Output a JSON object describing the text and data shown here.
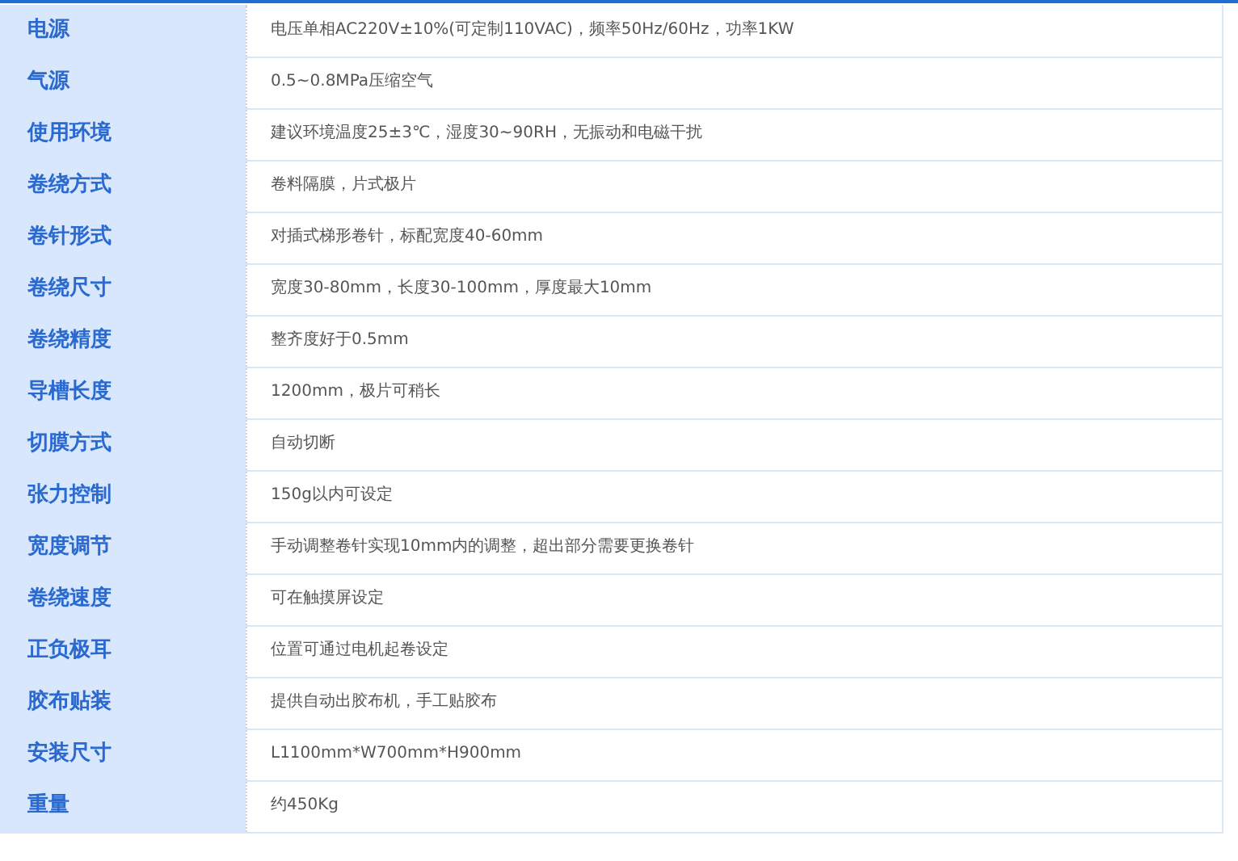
{
  "specs": [
    {
      "label": "电源",
      "value": "电压单相AC220V±10%(可定制110VAC)，频率50Hz/60Hz，功率1KW"
    },
    {
      "label": "气源",
      "value": "0.5~0.8MPa压缩空气"
    },
    {
      "label": "使用环境",
      "value": "建议环境温度25±3℃，湿度30~90RH，无振动和电磁干扰"
    },
    {
      "label": "卷绕方式",
      "value": "卷料隔膜，片式极片"
    },
    {
      "label": "卷针形式",
      "value": "对插式梯形卷针，标配宽度40-60mm"
    },
    {
      "label": "卷绕尺寸",
      "value": "宽度30-80mm，长度30-100mm，厚度最大10mm"
    },
    {
      "label": "卷绕精度",
      "value": "整齐度好于0.5mm"
    },
    {
      "label": "导槽长度",
      "value": "1200mm，极片可稍长"
    },
    {
      "label": "切膜方式",
      "value": "自动切断"
    },
    {
      "label": "张力控制",
      "value": "150g以内可设定"
    },
    {
      "label": "宽度调节",
      "value": "手动调整卷针实现10mm内的调整，超出部分需要更换卷针"
    },
    {
      "label": "卷绕速度",
      "value": "可在触摸屏设定"
    },
    {
      "label": "正负极耳",
      "value": "位置可通过电机起卷设定"
    },
    {
      "label": "胶布贴装",
      "value": "提供自动出胶布机，手工贴胶布"
    },
    {
      "label": "安装尺寸",
      "value": "L1100mm*W700mm*H900mm"
    },
    {
      "label": "重量",
      "value": "约450Kg"
    }
  ]
}
